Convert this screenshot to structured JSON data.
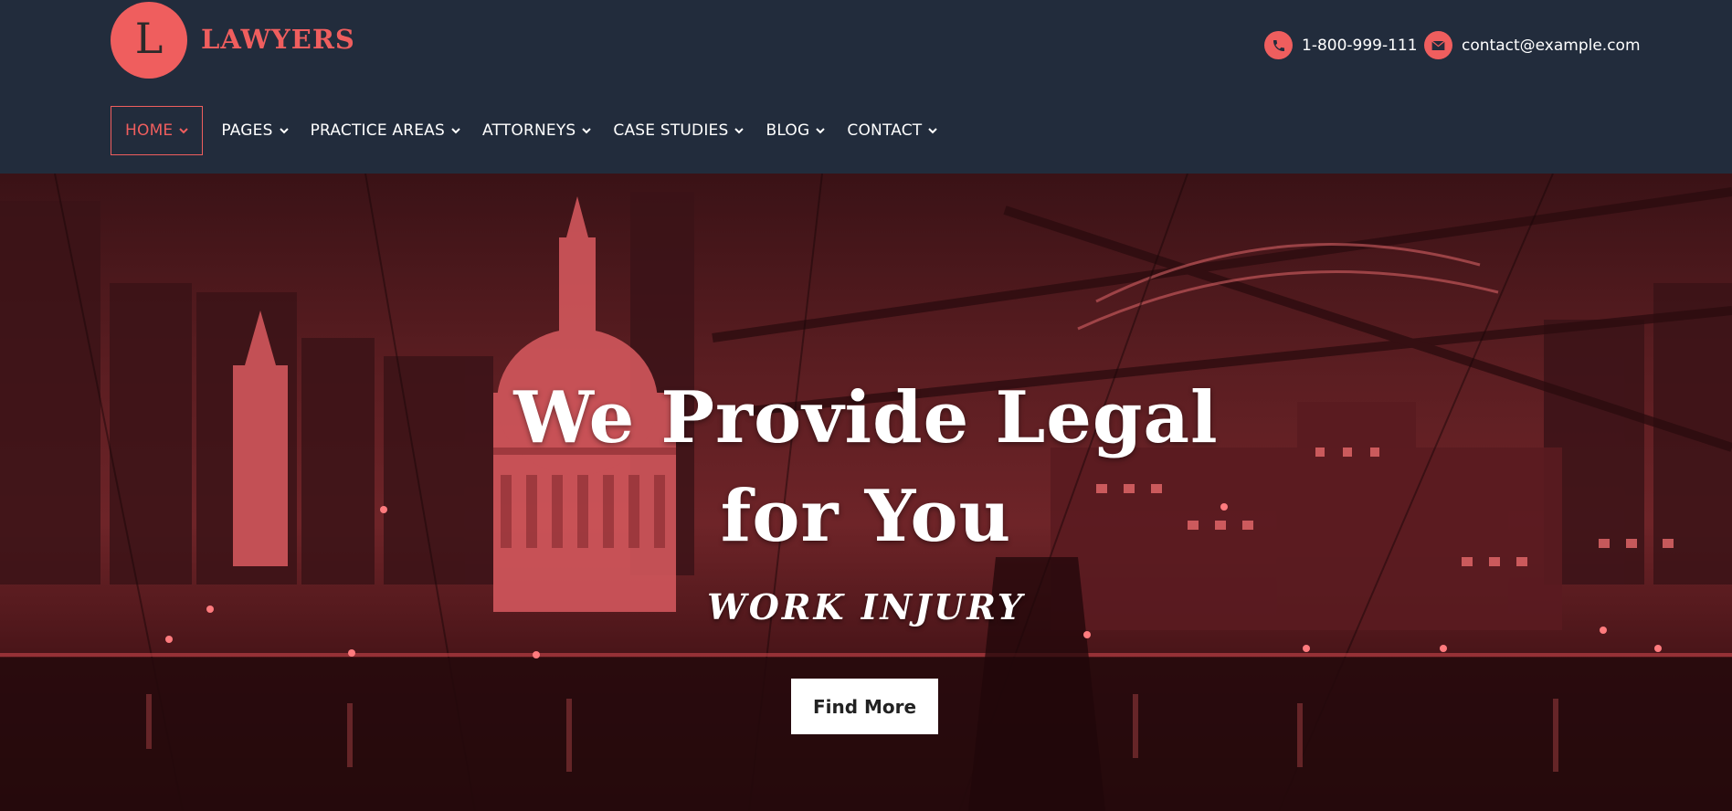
{
  "brand": {
    "letter": "L",
    "name": "LAWYERS"
  },
  "contacts": {
    "phone": {
      "icon": "phone-icon",
      "text": "1-800-999-111"
    },
    "email": {
      "icon": "envelope-icon",
      "text": "contact@example.com"
    }
  },
  "nav": {
    "items": [
      {
        "label": "HOME",
        "active": true
      },
      {
        "label": "PAGES"
      },
      {
        "label": "PRACTICE AREAS"
      },
      {
        "label": "ATTORNEYS"
      },
      {
        "label": "CASE STUDIES"
      },
      {
        "label": "BLOG"
      },
      {
        "label": "CONTACT"
      }
    ]
  },
  "hero": {
    "title_line1": "We Provide Legal",
    "title_line2": "for You",
    "subtitle": "WORK INJURY",
    "button": "Find More"
  },
  "colors": {
    "accent": "#ef5e5e",
    "header_bg": "#222c3c",
    "hero_tint": "#6e2428"
  }
}
